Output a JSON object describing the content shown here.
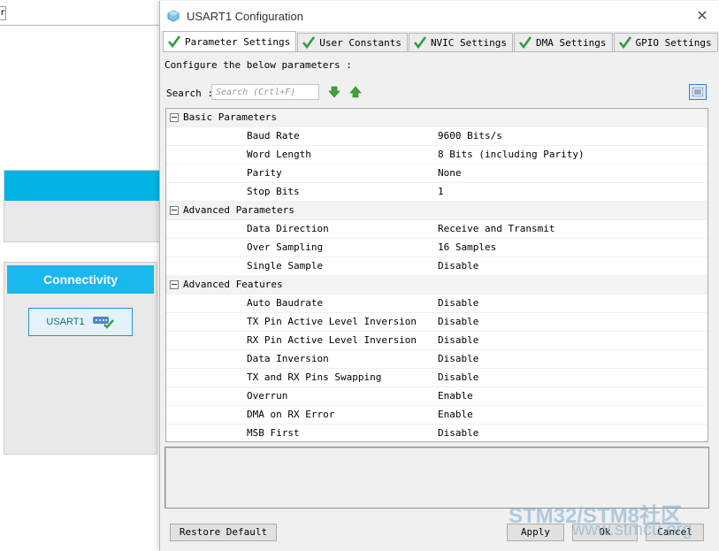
{
  "background": {
    "fragment_text": "r",
    "connectivity_label": "Connectivity",
    "usart_button_label": "USART1"
  },
  "dialog": {
    "title": "USART1 Configuration",
    "tabs": [
      {
        "label": "Parameter Settings",
        "active": true
      },
      {
        "label": "User Constants",
        "active": false
      },
      {
        "label": "NVIC Settings",
        "active": false
      },
      {
        "label": "DMA Settings",
        "active": false
      },
      {
        "label": "GPIO Settings",
        "active": false
      }
    ],
    "configure_text": "Configure the below parameters :",
    "search": {
      "label": "Search",
      "placeholder": "Search (Crtl+F)"
    },
    "sections": [
      {
        "label": "Basic Parameters",
        "params": [
          {
            "name": "Baud Rate",
            "value": "9600 Bits/s"
          },
          {
            "name": "Word Length",
            "value": "8 Bits (including Parity)"
          },
          {
            "name": "Parity",
            "value": "None"
          },
          {
            "name": "Stop Bits",
            "value": "1"
          }
        ]
      },
      {
        "label": "Advanced Parameters",
        "params": [
          {
            "name": "Data Direction",
            "value": "Receive and Transmit"
          },
          {
            "name": "Over Sampling",
            "value": "16 Samples"
          },
          {
            "name": "Single Sample",
            "value": "Disable"
          }
        ]
      },
      {
        "label": "Advanced Features",
        "params": [
          {
            "name": "Auto Baudrate",
            "value": "Disable"
          },
          {
            "name": "TX Pin Active Level Inversion",
            "value": "Disable"
          },
          {
            "name": "RX Pin Active Level Inversion",
            "value": "Disable"
          },
          {
            "name": "Data Inversion",
            "value": "Disable"
          },
          {
            "name": "TX and RX Pins Swapping",
            "value": "Disable"
          },
          {
            "name": "Overrun",
            "value": "Enable"
          },
          {
            "name": "DMA on RX Error",
            "value": "Enable"
          },
          {
            "name": "MSB First",
            "value": "Disable"
          }
        ]
      }
    ],
    "buttons": {
      "restore_default": "Restore Default",
      "apply": "Apply",
      "ok": "Ok",
      "cancel": "Cancel"
    }
  },
  "watermark": {
    "main": "STM32/STM8社区",
    "sub": "www.stmcu.org"
  },
  "colors": {
    "accent": "#03b3e6",
    "check_green": "#2e9e3e"
  }
}
